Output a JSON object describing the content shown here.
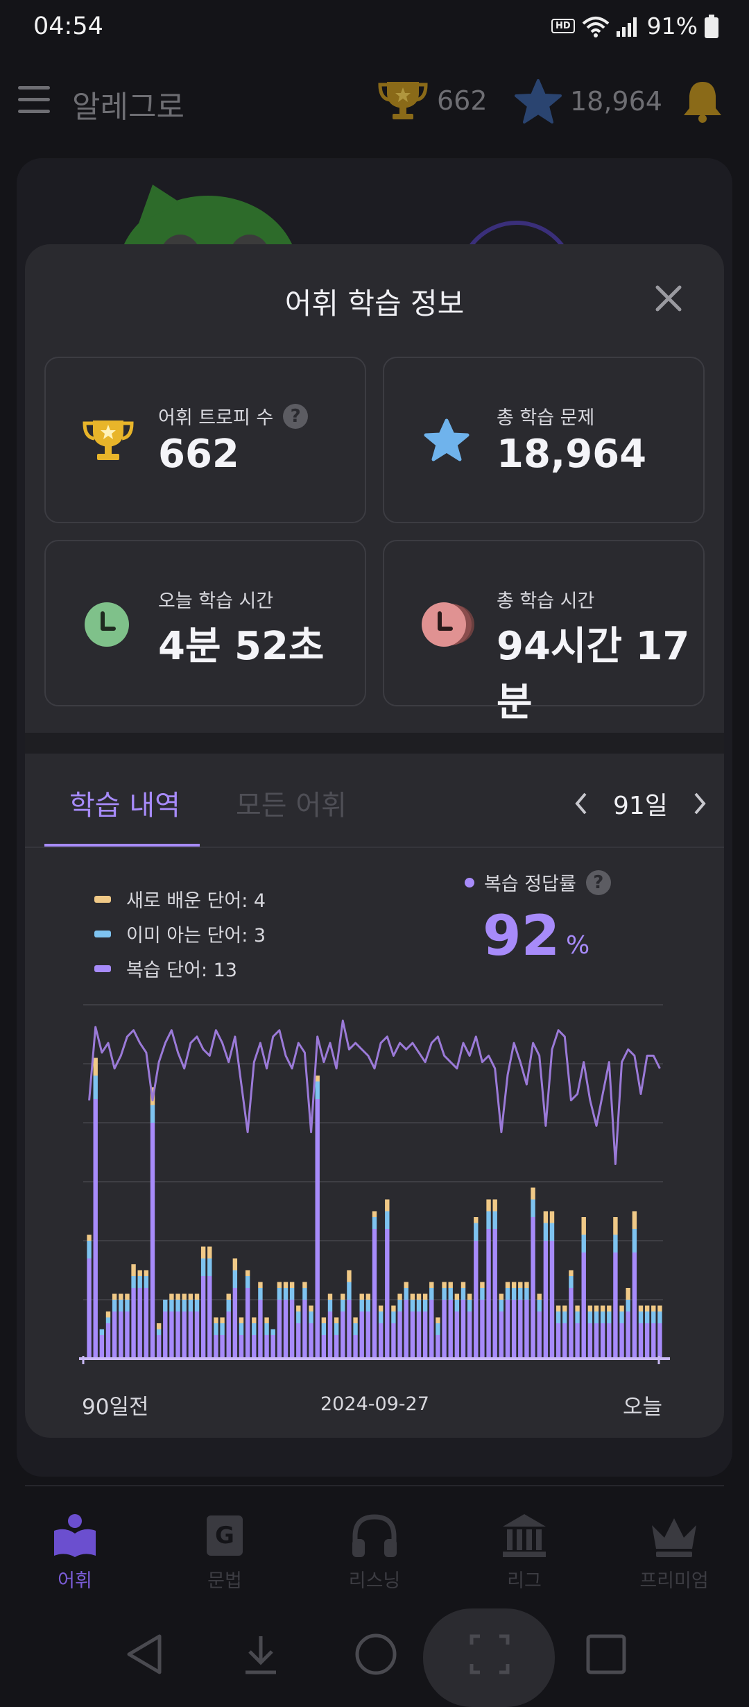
{
  "status_bar": {
    "time": "04:54",
    "hd_label": "HD",
    "battery": "91%"
  },
  "header": {
    "app_title": "알레그로",
    "trophy_count": "662",
    "star_count": "18,964"
  },
  "modal": {
    "title": "어휘 학습 정보",
    "cards": {
      "trophy": {
        "label": "어휘 트로피 수",
        "value": "662"
      },
      "total_questions": {
        "label": "총 학습 문제",
        "value": "18,964"
      },
      "today_time": {
        "label": "오늘 학습 시간",
        "value": "4분 52초"
      },
      "total_time": {
        "label": "총 학습 시간",
        "value": "94시간 17분"
      }
    },
    "help_glyph": "?",
    "tabs": [
      {
        "label": "학습 내역",
        "active": true
      },
      {
        "label": "모든 어휘",
        "active": false
      }
    ],
    "range": "91일",
    "legend": [
      {
        "label": "새로 배운 단어: 4",
        "color": "#f0c987"
      },
      {
        "label": "이미 아는 단어: 3",
        "color": "#7ec3f0"
      },
      {
        "label": "복습 단어: 13",
        "color": "#a78bfa"
      }
    ],
    "accuracy": {
      "label": "복습 정답률",
      "value": "92",
      "unit": "%"
    },
    "x_labels": {
      "start": "90일전",
      "mid": "2024-09-27",
      "end": "오늘"
    }
  },
  "chart_data": {
    "type": "bar",
    "description_series": [
      "새로 배운 단어",
      "이미 아는 단어",
      "복습 단어",
      "복습 정답률"
    ],
    "days": 91,
    "ylim": [
      0,
      60
    ],
    "accuracy_ylim": [
      0,
      100
    ],
    "series": [
      {
        "name": "새로 배운 단어",
        "color": "#f0c987",
        "values": [
          1,
          3,
          0,
          1,
          1,
          1,
          1,
          2,
          1,
          1,
          3,
          1,
          0,
          1,
          1,
          1,
          1,
          1,
          2,
          2,
          1,
          1,
          1,
          2,
          1,
          1,
          1,
          1,
          1,
          0,
          1,
          1,
          1,
          1,
          1,
          1,
          1,
          1,
          1,
          1,
          1,
          2,
          1,
          1,
          1,
          1,
          1,
          2,
          1,
          1,
          1,
          1,
          1,
          1,
          1,
          1,
          1,
          1,
          1,
          1,
          1,
          1,
          1,
          2,
          2,
          1,
          1,
          1,
          1,
          1,
          2,
          1,
          2,
          2,
          1,
          1,
          1,
          1,
          3,
          1,
          1,
          1,
          1,
          3,
          1,
          2,
          3,
          1,
          1,
          1,
          1
        ]
      },
      {
        "name": "이미 아는 단어",
        "color": "#7ec3f0",
        "values": [
          3,
          4,
          1,
          1,
          2,
          2,
          2,
          2,
          2,
          2,
          3,
          1,
          2,
          2,
          2,
          2,
          2,
          2,
          3,
          3,
          2,
          2,
          2,
          3,
          2,
          2,
          2,
          2,
          2,
          1,
          2,
          2,
          2,
          2,
          2,
          2,
          3,
          2,
          2,
          2,
          2,
          3,
          2,
          2,
          2,
          2,
          2,
          3,
          2,
          2,
          2,
          2,
          2,
          2,
          2,
          2,
          2,
          2,
          2,
          2,
          2,
          3,
          2,
          3,
          3,
          2,
          2,
          2,
          2,
          2,
          3,
          2,
          3,
          3,
          2,
          2,
          2,
          2,
          3,
          2,
          2,
          2,
          2,
          3,
          2,
          2,
          4,
          2,
          2,
          2,
          2
        ]
      },
      {
        "name": "복습 단어",
        "color": "#a78bfa",
        "values": [
          17,
          44,
          4,
          6,
          8,
          8,
          8,
          12,
          12,
          12,
          40,
          4,
          8,
          8,
          8,
          8,
          8,
          8,
          14,
          14,
          4,
          4,
          8,
          12,
          4,
          12,
          4,
          10,
          4,
          4,
          10,
          10,
          10,
          6,
          10,
          6,
          44,
          4,
          8,
          4,
          8,
          10,
          4,
          8,
          8,
          22,
          6,
          22,
          6,
          8,
          10,
          8,
          8,
          8,
          10,
          4,
          10,
          10,
          8,
          10,
          8,
          20,
          10,
          22,
          22,
          8,
          10,
          10,
          10,
          10,
          24,
          8,
          20,
          20,
          6,
          6,
          12,
          6,
          18,
          6,
          6,
          6,
          6,
          18,
          6,
          8,
          18,
          6,
          6,
          6,
          6
        ]
      },
      {
        "name": "복습 정답률",
        "values": [
          70,
          93,
          85,
          88,
          80,
          84,
          90,
          92,
          88,
          85,
          70,
          82,
          88,
          92,
          85,
          80,
          88,
          90,
          86,
          84,
          92,
          88,
          82,
          90,
          75,
          60,
          82,
          88,
          80,
          90,
          92,
          84,
          80,
          88,
          85,
          60,
          90,
          82,
          88,
          80,
          95,
          86,
          88,
          86,
          84,
          80,
          88,
          90,
          84,
          88,
          86,
          88,
          85,
          82,
          88,
          90,
          84,
          82,
          80,
          88,
          84,
          90,
          82,
          84,
          80,
          60,
          78,
          88,
          82,
          75,
          88,
          84,
          62,
          86,
          92,
          90,
          70,
          72,
          82,
          70,
          62,
          72,
          82,
          50,
          82,
          86,
          84,
          72,
          84,
          84,
          80
        ]
      }
    ]
  },
  "bottom_nav": [
    {
      "label": "어휘",
      "active": true
    },
    {
      "label": "문법",
      "active": false
    },
    {
      "label": "리스닝",
      "active": false
    },
    {
      "label": "리그",
      "active": false
    },
    {
      "label": "프리미엄",
      "active": false
    }
  ]
}
